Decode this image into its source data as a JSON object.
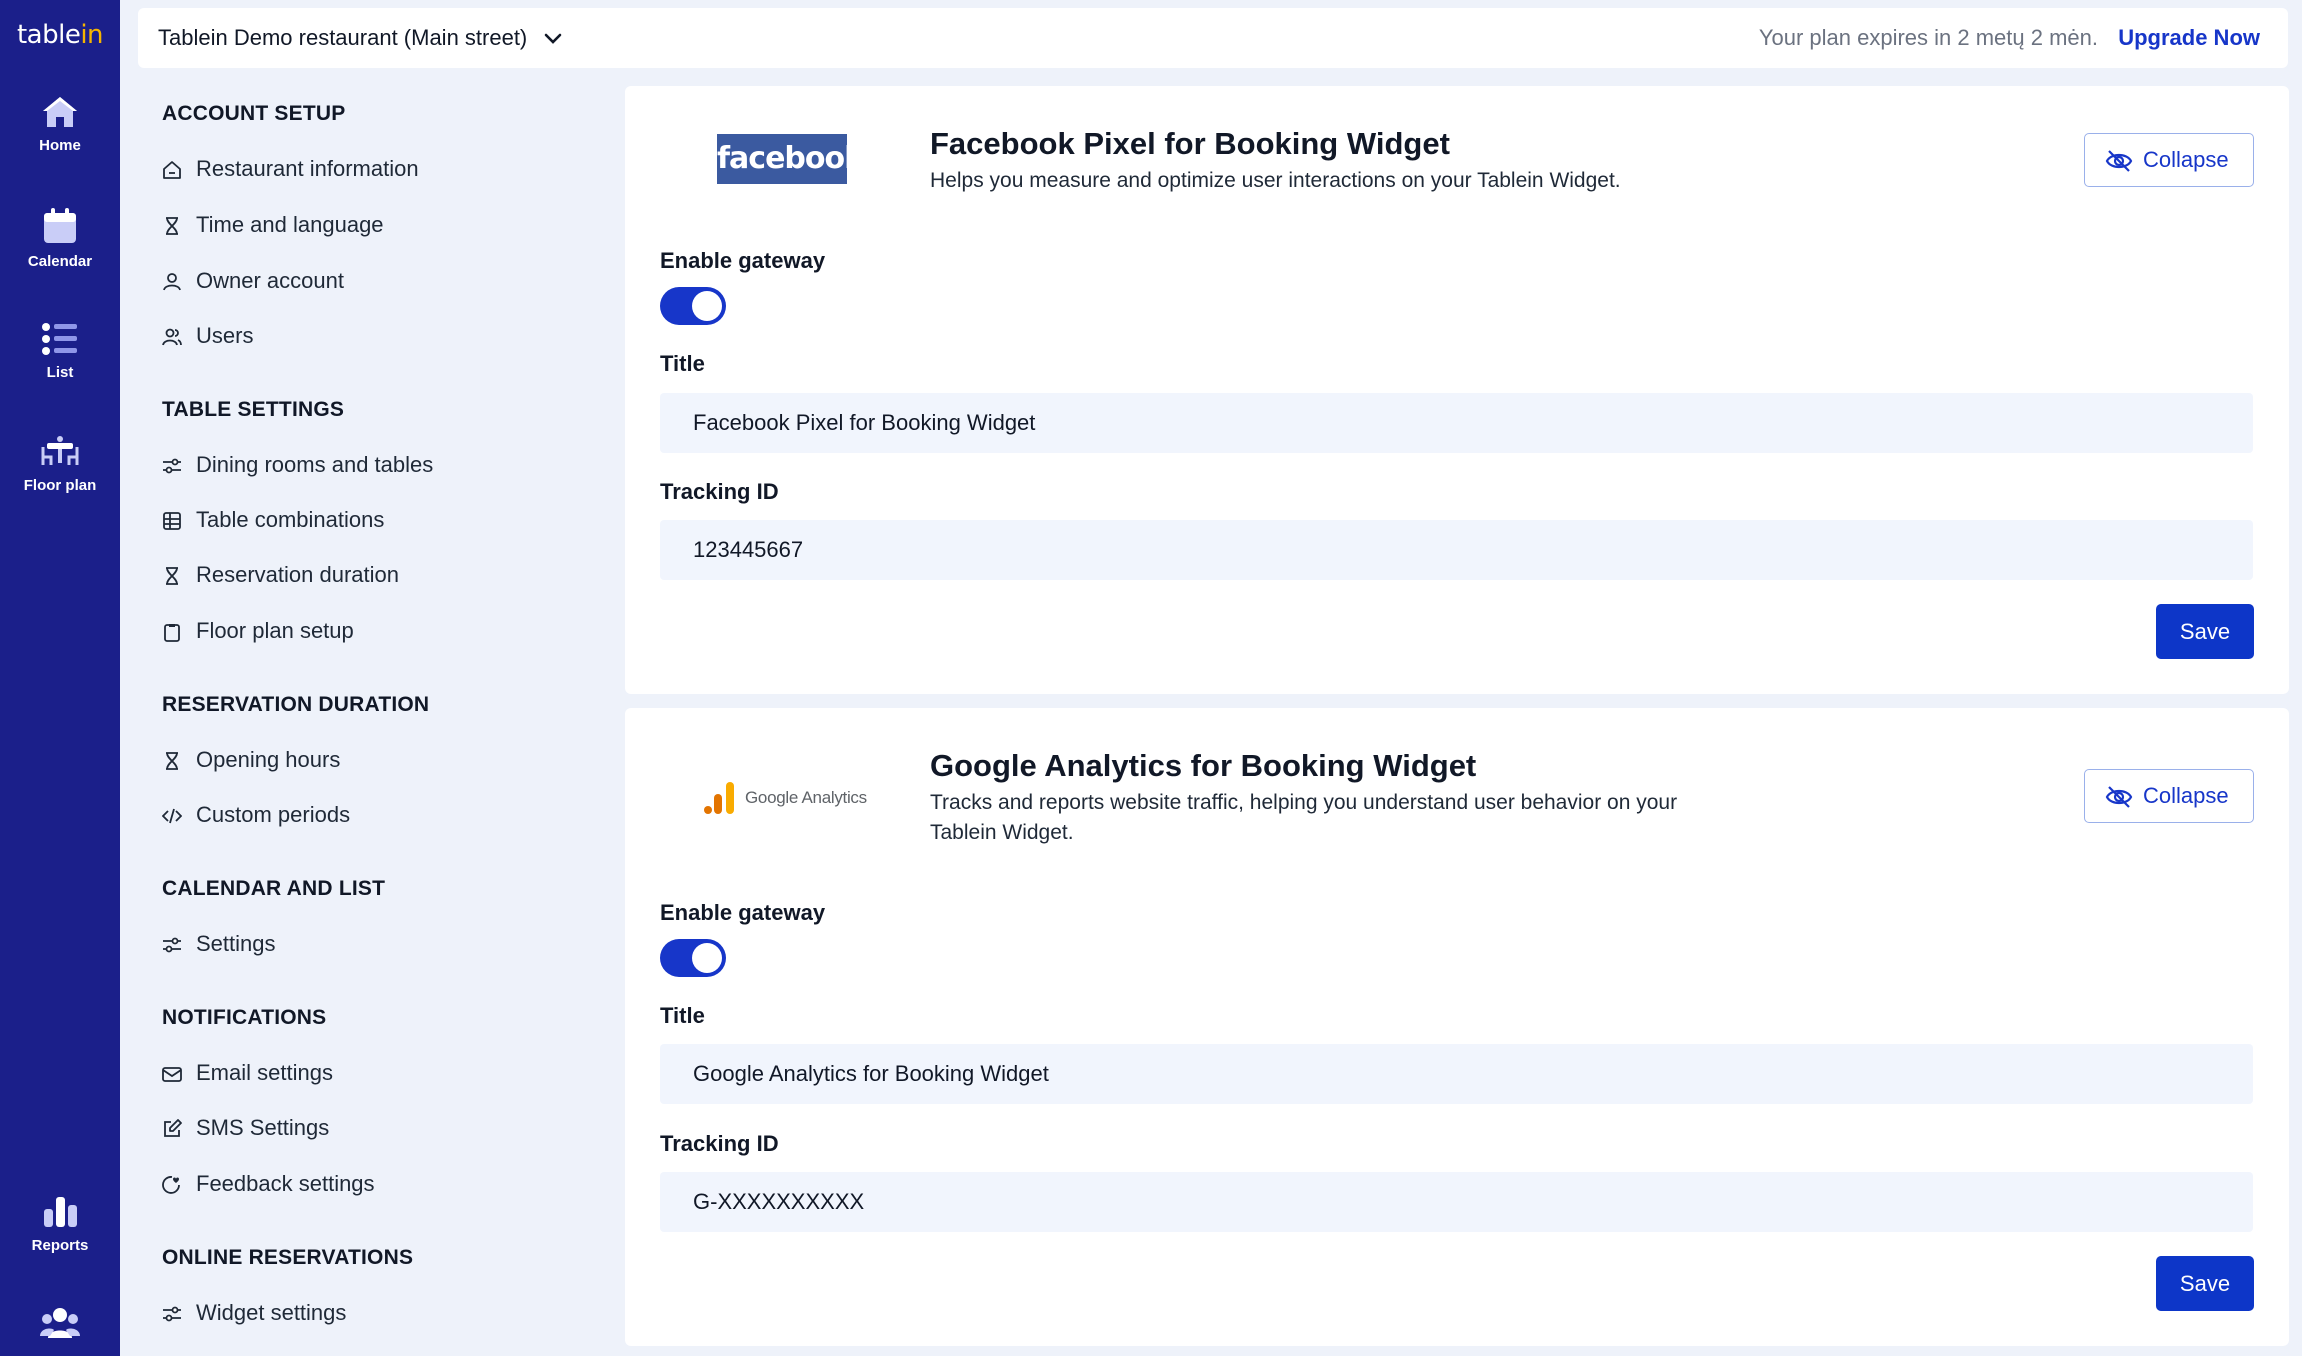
{
  "app": {
    "brand_main": "table",
    "brand_accent": "in"
  },
  "rail": {
    "home": "Home",
    "calendar": "Calendar",
    "list": "List",
    "floor_plan": "Floor plan",
    "reports": "Reports"
  },
  "topbar": {
    "venue": "Tablein Demo restaurant (Main street)",
    "plan_text": "Your plan expires in 2 metų 2 mėn.",
    "upgrade": "Upgrade Now"
  },
  "nav": {
    "account_setup": "ACCOUNT SETUP",
    "restaurant_information": "Restaurant information",
    "time_and_language": "Time and language",
    "owner_account": "Owner account",
    "users": "Users",
    "table_settings": "TABLE SETTINGS",
    "dining_rooms": "Dining rooms and tables",
    "table_combinations": "Table combinations",
    "reservation_duration_item": "Reservation duration",
    "floor_plan_setup": "Floor plan setup",
    "reservation_duration": "RESERVATION DURATION",
    "opening_hours": "Opening hours",
    "custom_periods": "Custom periods",
    "calendar_and_list": "CALENDAR AND LIST",
    "settings": "Settings",
    "notifications": "NOTIFICATIONS",
    "email_settings": "Email settings",
    "sms_settings": "SMS Settings",
    "feedback_settings": "Feedback settings",
    "online_reservations": "ONLINE RESERVATIONS",
    "widget_settings": "Widget settings"
  },
  "facebook": {
    "logo_text": "facebook",
    "title": "Facebook Pixel for Booking Widget",
    "desc": "Helps you measure and optimize user interactions on your Tablein Widget.",
    "collapse": "Collapse",
    "enable_label": "Enable gateway",
    "enabled": true,
    "title_label": "Title",
    "title_value": "Facebook Pixel for Booking Widget",
    "tracking_label": "Tracking ID",
    "tracking_value": "123445667",
    "save": "Save"
  },
  "google": {
    "logo_text": "Google Analytics",
    "title": "Google Analytics for Booking Widget",
    "desc": "Tracks and reports website traffic, helping you understand user behavior on your Tablein Widget.",
    "collapse": "Collapse",
    "enable_label": "Enable gateway",
    "enabled": true,
    "title_label": "Title",
    "title_value": "Google Analytics for Booking Widget",
    "tracking_label": "Tracking ID",
    "tracking_value": "G-XXXXXXXXXX",
    "save": "Save"
  },
  "colors": {
    "rail_bg": "#1b1f8a",
    "accent": "#1736c9",
    "button": "#0d36c8",
    "page_bg": "#eef2fa",
    "input_bg": "#f1f5fd"
  }
}
